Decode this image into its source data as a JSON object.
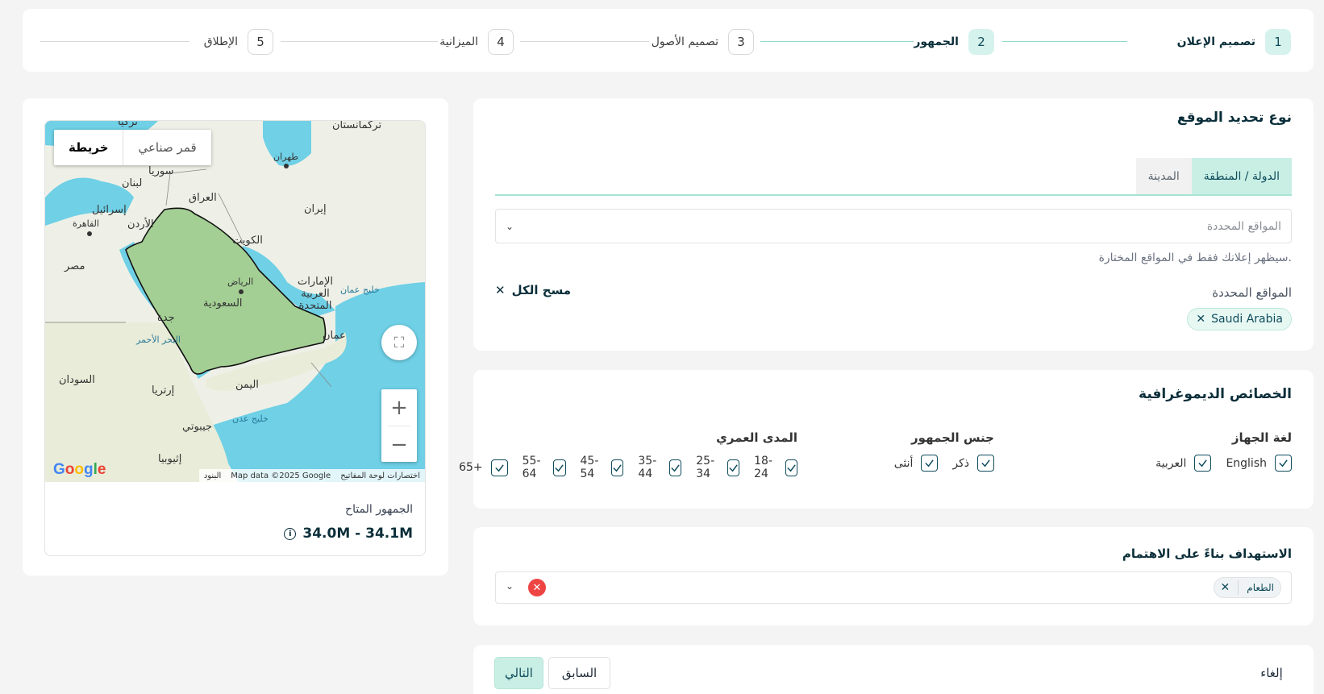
{
  "stepper": {
    "steps": [
      {
        "num": "1",
        "label": "تصميم الإعلان"
      },
      {
        "num": "2",
        "label": "الجمهور"
      },
      {
        "num": "3",
        "label": "تصميم الأصول"
      },
      {
        "num": "4",
        "label": "الميزانية"
      },
      {
        "num": "5",
        "label": "الإطلاق"
      }
    ]
  },
  "location": {
    "title": "نوع تحديد الموقع",
    "tabs": [
      "الدولة / المنطقة",
      "المدينة"
    ],
    "select_placeholder": "المواقع المحددة",
    "hint": "سيظهر إعلانك فقط في المواقع المختارة.",
    "selected_label": "المواقع المحددة",
    "clear_all": "مسح الكل",
    "chips": [
      "Saudi Arabia"
    ]
  },
  "demographics": {
    "title": "الخصائص الديموغرافية",
    "language": {
      "title": "لغة الجهاز",
      "options": [
        "English",
        "العربية"
      ]
    },
    "gender": {
      "title": "جنس الجمهور",
      "options": [
        "ذكر",
        "أنثى"
      ]
    },
    "age": {
      "title": "المدى العمري",
      "options": [
        "18-24",
        "25-34",
        "35-44",
        "45-54",
        "55-64",
        "65+"
      ]
    }
  },
  "interest": {
    "title": "الاستهداف بناءً على الاهتمام",
    "tags": [
      "الطعام"
    ]
  },
  "footer": {
    "next": "التالي",
    "prev": "السابق",
    "cancel": "إلغاء"
  },
  "map": {
    "type_map": "خريطة",
    "type_satellite": "قمر صناعي",
    "attribution_shortcuts": "اختصارات لوحة المفاتيح",
    "attribution_data": "Map data ©2025 Google",
    "attribution_terms": "البنود",
    "google_logo": "Google",
    "labels": {
      "turkmenistan": "تركمانستان",
      "tehran": "طهران",
      "syria": "سوريا",
      "lebanon": "لبنان",
      "iraq": "العراق",
      "iran": "إيران",
      "israel": "إسرائيل",
      "cairo": "القاهرة",
      "jordan": "الأردن",
      "kuwait": "الكويت",
      "egypt": "مصر",
      "riyadh": "الرياض",
      "saudi": "السعودية",
      "uae": "الإمارات العربية المتحدة",
      "oman_gulf": "خليج عمان",
      "jeddah": "جدة",
      "oman": "عمان",
      "red_sea": "البحر الأحمر",
      "sudan": "السودان",
      "eritrea": "إرتريا",
      "yemen": "اليمن",
      "aden_gulf": "خليج عدن",
      "djibouti": "جيبوتي",
      "ethiopia": "إثيوبيا",
      "turkey_partial": "تركيا"
    }
  },
  "audience": {
    "label": "الجمهور المتاح",
    "value": "34.0M - 34.1M"
  },
  "colors": {
    "accent": "#c9efe5",
    "primary_text": "#0b2f3a",
    "danger": "#ef4444"
  }
}
